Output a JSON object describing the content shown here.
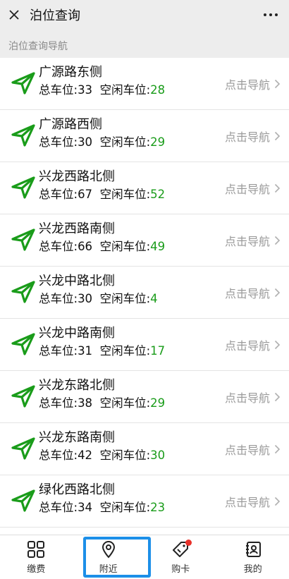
{
  "header": {
    "title": "泊位查询"
  },
  "section": {
    "label": "泊位查询导航"
  },
  "list": {
    "total_prefix": "总车位:",
    "free_prefix": "空闲车位:",
    "nav_label": "点击导航",
    "items": [
      {
        "name": "广源路东侧",
        "total": "33",
        "free": "28"
      },
      {
        "name": "广源路西侧",
        "total": "30",
        "free": "29"
      },
      {
        "name": "兴龙西路北侧",
        "total": "67",
        "free": "52"
      },
      {
        "name": "兴龙西路南侧",
        "total": "66",
        "free": "49"
      },
      {
        "name": "兴龙中路北侧",
        "total": "30",
        "free": "4"
      },
      {
        "name": "兴龙中路南侧",
        "total": "31",
        "free": "17"
      },
      {
        "name": "兴龙东路北侧",
        "total": "38",
        "free": "29"
      },
      {
        "name": "兴龙东路南侧",
        "total": "42",
        "free": "30"
      },
      {
        "name": "绿化西路北侧",
        "total": "34",
        "free": "23"
      }
    ]
  },
  "tabbar": {
    "tabs": [
      {
        "label": "缴费",
        "icon": "grid-icon"
      },
      {
        "label": "附近",
        "icon": "location-pin-icon"
      },
      {
        "label": "购卡",
        "icon": "tag-icon"
      },
      {
        "label": "我的",
        "icon": "profile-card-icon"
      }
    ],
    "selected": "附近"
  },
  "colors": {
    "accent_green": "#1a9c1a",
    "selection_blue": "#1c8fe8",
    "badge_red": "#e8312a"
  }
}
